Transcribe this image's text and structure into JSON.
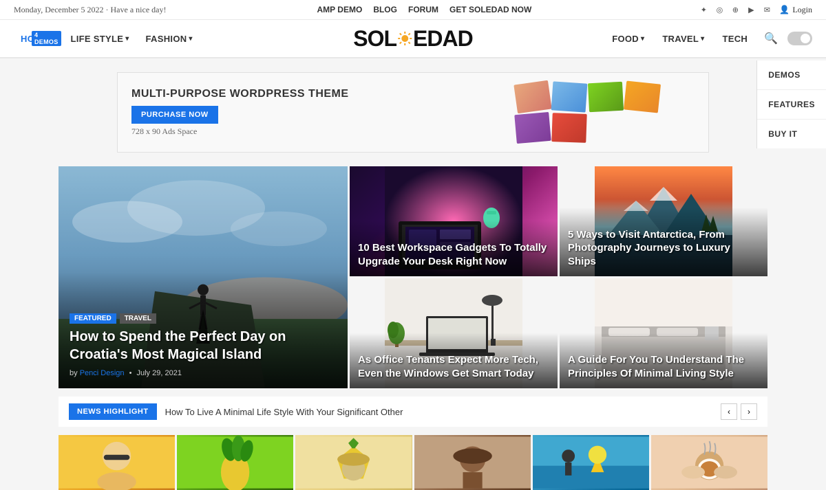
{
  "topbar": {
    "date_text": "Monday, December 5 2022 · Have a nice day!",
    "links": [
      "AMP DEMO",
      "BLOG",
      "FORUM",
      "GET SOLEDAD NOW"
    ],
    "login": "Login"
  },
  "nav": {
    "logo": "SOLEDAD",
    "left_items": [
      {
        "label": "HOME",
        "active": true,
        "badge": "4 DEMOS"
      },
      {
        "label": "LIFE STYLE",
        "dropdown": true
      },
      {
        "label": "FASHION",
        "dropdown": true
      }
    ],
    "right_items": [
      {
        "label": "FOOD",
        "dropdown": true
      },
      {
        "label": "TRAVEL",
        "dropdown": true
      },
      {
        "label": "TECH",
        "dropdown": false
      }
    ]
  },
  "right_sidebar": {
    "items": [
      "DEMOS",
      "FEATURES",
      "BUY IT"
    ]
  },
  "ad_banner": {
    "theme": "MULTI-PURPOSE WORDPRESS THEME",
    "btn_label": "PURCHASE NOW",
    "size_text": "728 x 90 Ads Space"
  },
  "featured_articles": [
    {
      "id": "featured-main",
      "tags": [
        "Featured",
        "Travel"
      ],
      "title": "How to Spend the Perfect Day on Croatia's Most Magical Island",
      "author": "Penci Design",
      "date": "July 29, 2021",
      "bg": "croatia"
    },
    {
      "id": "workspace",
      "tags": [],
      "title": "10 Best Workspace Gadgets To Totally Upgrade Your Desk Right Now",
      "bg": "workspace"
    },
    {
      "id": "antarctica",
      "tags": [],
      "title": "5 Ways to Visit Antarctica, From Photography Journeys to Luxury Ships",
      "bg": "antarctica"
    },
    {
      "id": "office",
      "tags": [],
      "title": "As Office Tenants Expect More Tech, Even the Windows Get Smart Today",
      "bg": "office"
    },
    {
      "id": "minimal",
      "tags": [],
      "title": "A Guide For You To Understand The Principles Of Minimal Living Style",
      "bg": "minimal"
    }
  ],
  "news_highlight": {
    "badge": "NEWS HIGHLIGHT",
    "text": "How To Live A Minimal Life Style With Your Significant Other"
  },
  "thumbnails": [
    {
      "bg": "thumb-bg-1"
    },
    {
      "bg": "thumb-bg-2"
    },
    {
      "bg": "thumb-bg-3"
    },
    {
      "bg": "thumb-bg-4"
    },
    {
      "bg": "thumb-bg-5"
    },
    {
      "bg": "thumb-bg-6"
    }
  ],
  "social_icons": [
    "f",
    "t",
    "ig",
    "p",
    "yt",
    "em"
  ]
}
